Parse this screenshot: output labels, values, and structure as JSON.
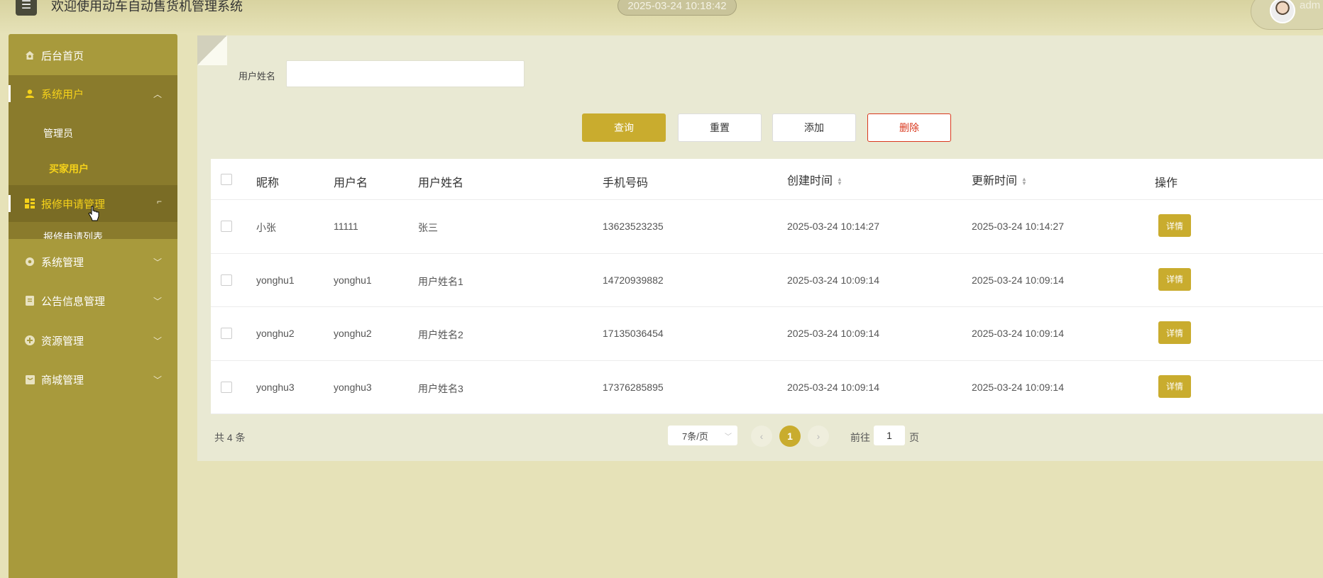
{
  "header": {
    "menu_icon": "hamburger-icon",
    "title": "欢迎使用动车自动售货机管理系统",
    "datetime": "2025-03-24 10:18:42",
    "username": "adm"
  },
  "sidebar": {
    "items": [
      {
        "label": "后台首页",
        "icon": "home-icon"
      },
      {
        "label": "系统用户",
        "icon": "user-icon",
        "expanded": true,
        "children": [
          {
            "label": "管理员"
          },
          {
            "label": "买家用户",
            "current": true
          }
        ]
      },
      {
        "label": "报修申请管理",
        "icon": "grid-icon",
        "expanded": true,
        "children": [
          {
            "label": "报修申请列表"
          }
        ]
      },
      {
        "label": "系统管理",
        "icon": "gear-icon"
      },
      {
        "label": "公告信息管理",
        "icon": "document-icon"
      },
      {
        "label": "资源管理",
        "icon": "plus-circle-icon"
      },
      {
        "label": "商城管理",
        "icon": "shop-icon"
      }
    ]
  },
  "filter": {
    "label": "用户姓名",
    "value": "",
    "placeholder": ""
  },
  "actions": {
    "query": "查询",
    "reset": "重置",
    "add": "添加",
    "delete": "删除"
  },
  "table": {
    "columns": [
      "昵称",
      "用户名",
      "用户姓名",
      "手机号码",
      "创建时间",
      "更新时间",
      "操作"
    ],
    "rows": [
      {
        "nickname": "小张",
        "username": "11111",
        "realname": "张三",
        "phone": "13623523235",
        "created": "2025-03-24 10:14:27",
        "updated": "2025-03-24 10:14:27",
        "action": "详情"
      },
      {
        "nickname": "yonghu1",
        "username": "yonghu1",
        "realname": "用户姓名1",
        "phone": "14720939882",
        "created": "2025-03-24 10:09:14",
        "updated": "2025-03-24 10:09:14",
        "action": "详情"
      },
      {
        "nickname": "yonghu2",
        "username": "yonghu2",
        "realname": "用户姓名2",
        "phone": "17135036454",
        "created": "2025-03-24 10:09:14",
        "updated": "2025-03-24 10:09:14",
        "action": "详情"
      },
      {
        "nickname": "yonghu3",
        "username": "yonghu3",
        "realname": "用户姓名3",
        "phone": "17376285895",
        "created": "2025-03-24 10:09:14",
        "updated": "2025-03-24 10:09:14",
        "action": "详情"
      }
    ]
  },
  "pagination": {
    "total": "共 4 条",
    "page_size": "7条/页",
    "current_page": "1",
    "goto_label": "前往",
    "goto_value": "1",
    "goto_suffix": "页"
  },
  "colors": {
    "accent": "#c9ac2e",
    "sidebar": "#a89a3c",
    "active_text": "#f6d21a",
    "danger": "#d9371c"
  }
}
